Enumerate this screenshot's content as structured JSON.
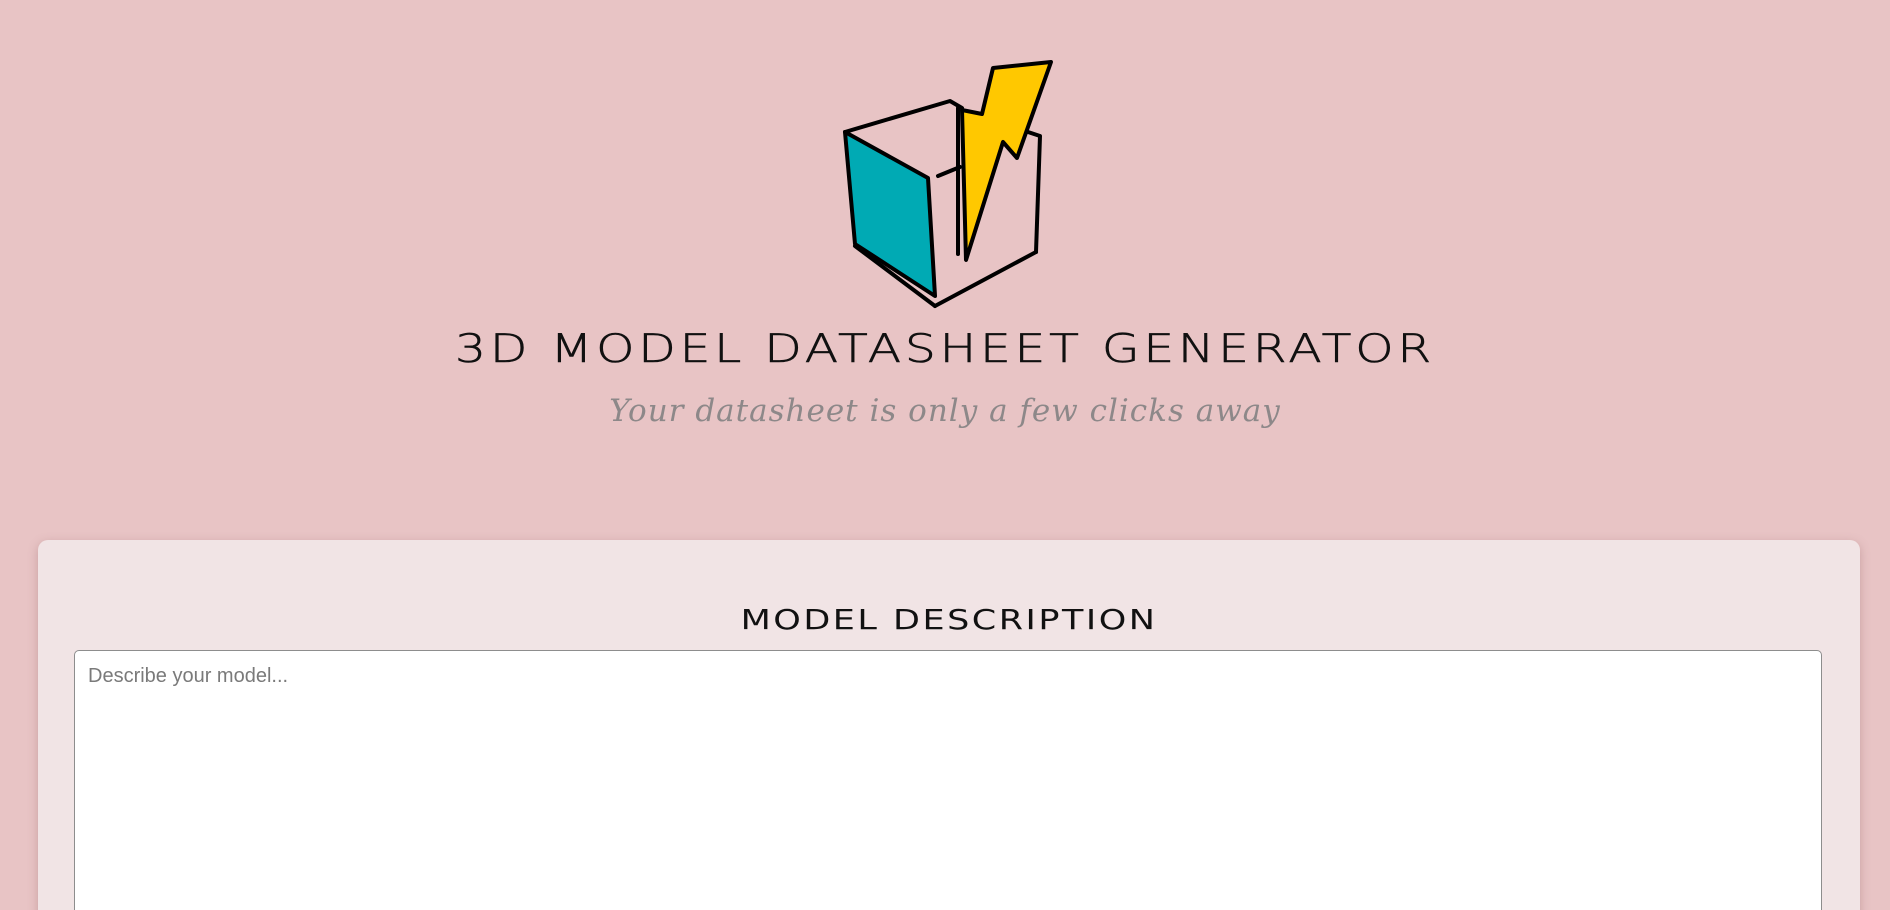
{
  "header": {
    "logo_icon": "box-lightning-logo-icon",
    "title": "3D MODEL DATASHEET GENERATOR",
    "subtitle": "Your datasheet is only a few clicks away"
  },
  "form": {
    "section_label": "MODEL DESCRIPTION",
    "description_value": "",
    "description_placeholder": "Describe your model..."
  },
  "colors": {
    "background": "#e8c4c5",
    "card": "#f1e4e5",
    "logo_teal": "#00aab4",
    "logo_yellow": "#ffc800"
  }
}
